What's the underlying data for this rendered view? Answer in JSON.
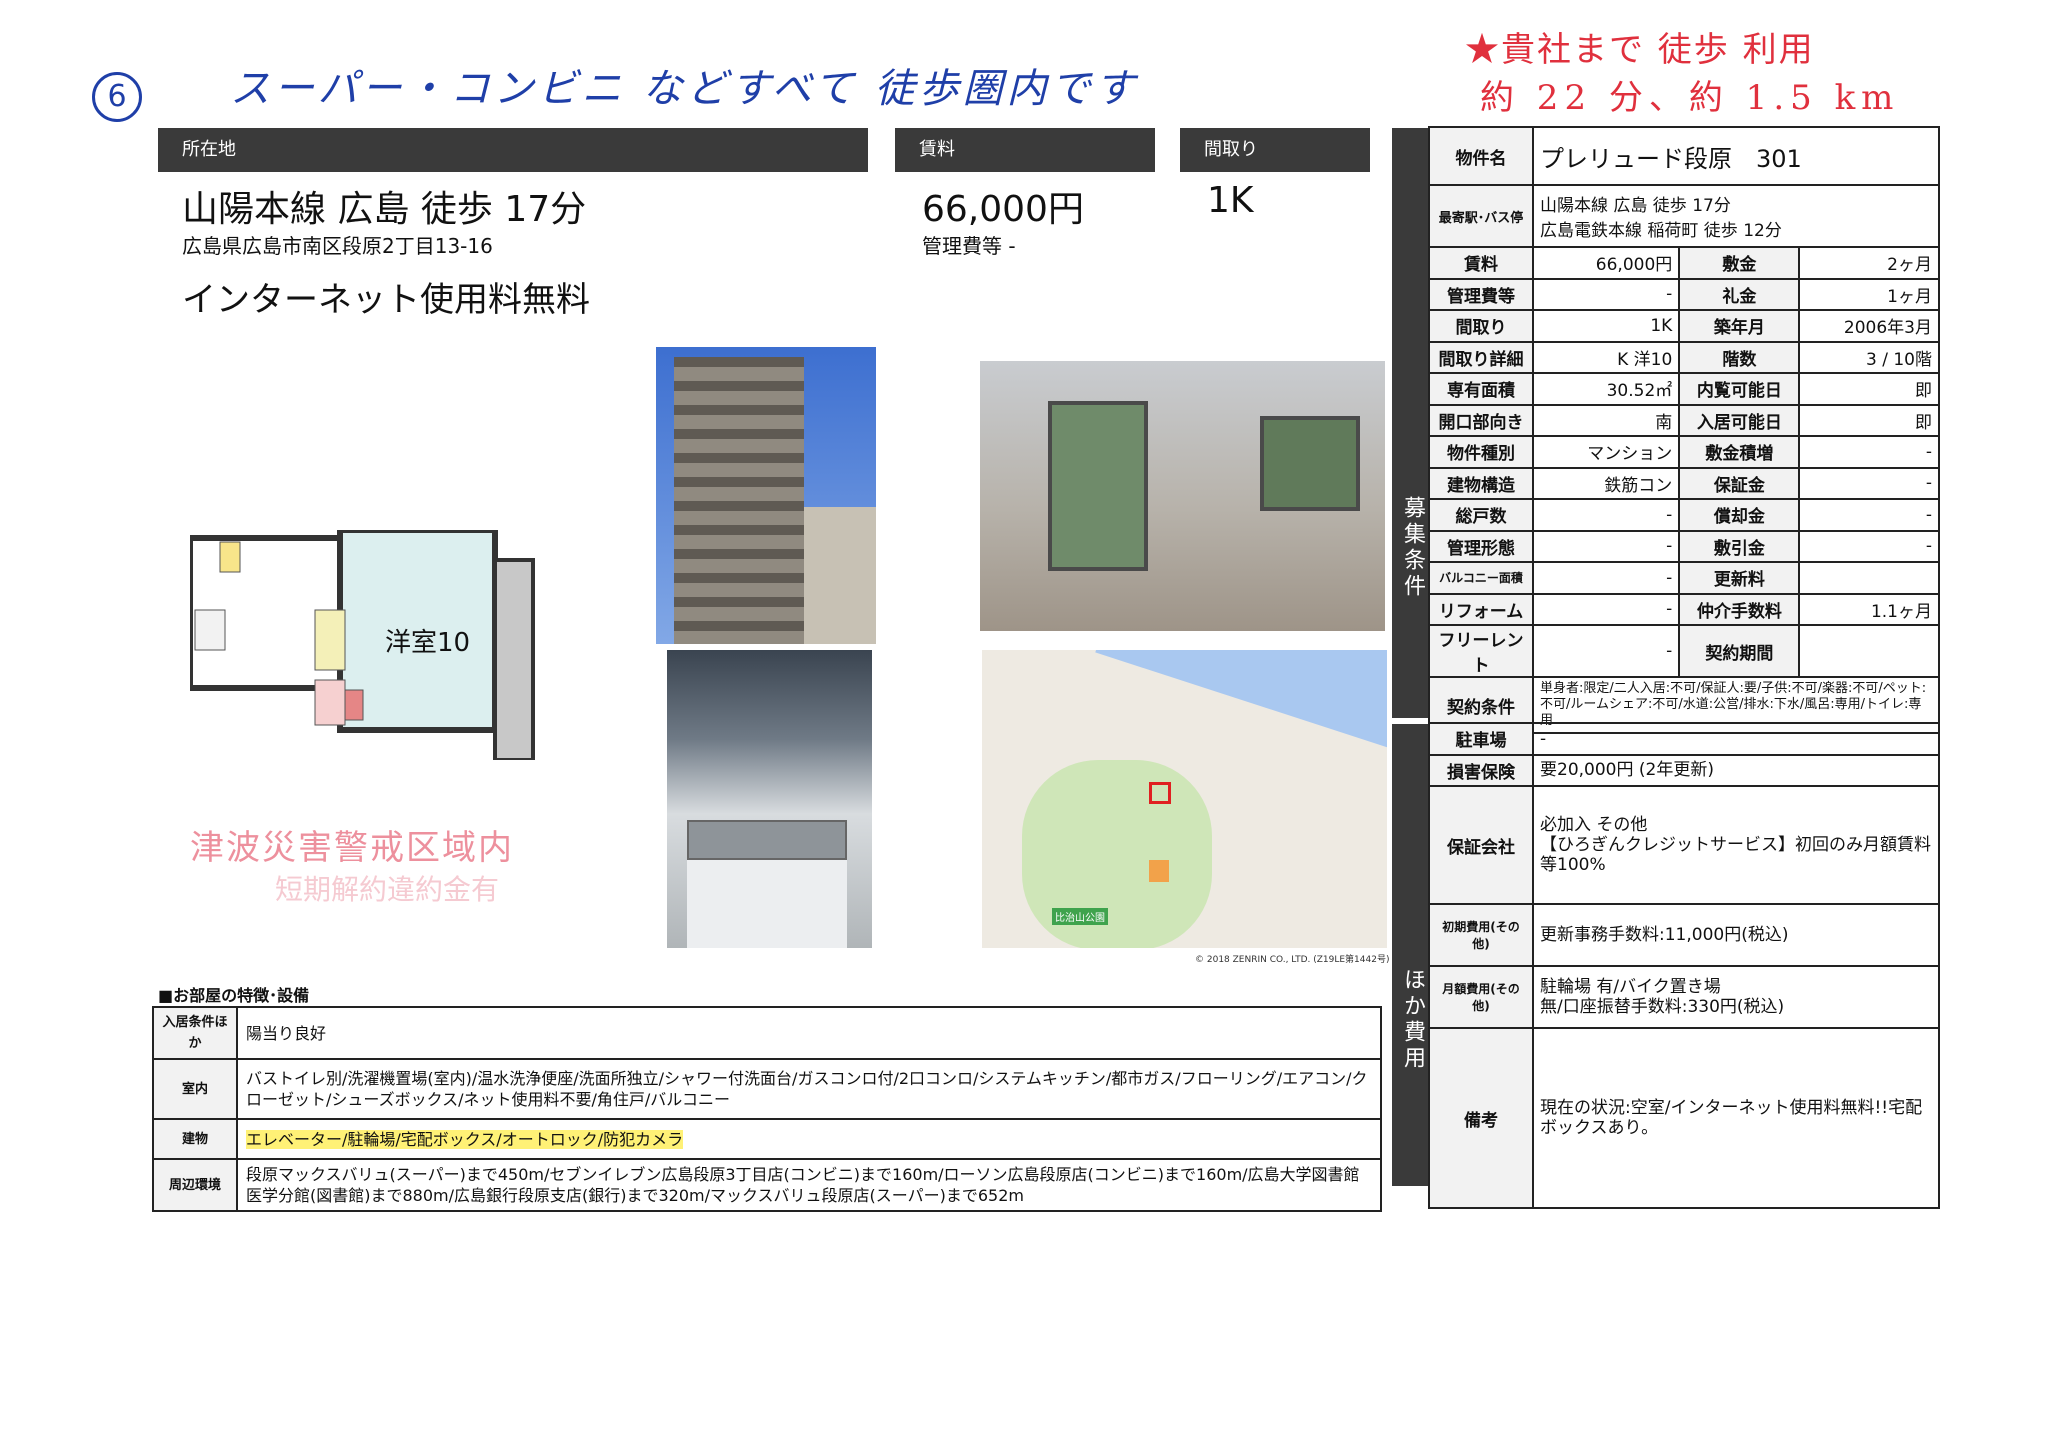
{
  "handwritten": {
    "number": "6",
    "note": "スーパー・コンビニ などすべて 徒歩圏内です",
    "top_right_line1": "★貴社まで 徒歩 利用",
    "top_right_line2": "約 22 分、約 1.5 km"
  },
  "headers": {
    "location": "所在地",
    "rent": "賃料",
    "layout": "間取り"
  },
  "summary": {
    "station": "山陽本線 広島 徒歩 17分",
    "address": "広島県広島市南区段原2丁目13-16",
    "rent": "66,000円",
    "mgmt_fee": "管理費等 -",
    "layout": "1K",
    "catch": "インターネット使用料無料"
  },
  "floorplan": {
    "room_label": "洋室10",
    "stamp_line1": "津波災害警戒区域内",
    "stamp_line2": "短期解約違約金有"
  },
  "map": {
    "copyright": "© 2018 ZENRIN CO., LTD. (Z19LE第1442号)",
    "park_label": "比治山公園"
  },
  "spec": {
    "property_name_label": "物件名",
    "property_name": "プレリュード段原　301",
    "station_label": "最寄駅･バス停",
    "station_line1": "山陽本線 広島 徒歩 17分",
    "station_line2": "広島電鉄本線 稲荷町 徒歩 12分",
    "section_label": "募集条件",
    "rows": [
      {
        "l1": "賃料",
        "v1": "66,000円",
        "l2": "敷金",
        "v2": "2ヶ月"
      },
      {
        "l1": "管理費等",
        "v1": "-",
        "l2": "礼金",
        "v2": "1ヶ月"
      },
      {
        "l1": "間取り",
        "v1": "1K",
        "l2": "築年月",
        "v2": "2006年3月"
      },
      {
        "l1": "間取り詳細",
        "v1": "K 洋10",
        "l2": "階数",
        "v2": "3 / 10階"
      },
      {
        "l1": "専有面積",
        "v1": "30.52㎡",
        "l2": "内覧可能日",
        "v2": "即"
      },
      {
        "l1": "開口部向き",
        "v1": "南",
        "l2": "入居可能日",
        "v2": "即"
      },
      {
        "l1": "物件種別",
        "v1": "マンション",
        "l2": "敷金積増",
        "v2": "-"
      },
      {
        "l1": "建物構造",
        "v1": "鉄筋コン",
        "l2": "保証金",
        "v2": "-"
      },
      {
        "l1": "総戸数",
        "v1": "-",
        "l2": "償却金",
        "v2": "-"
      },
      {
        "l1": "管理形態",
        "v1": "-",
        "l2": "敷引金",
        "v2": "-"
      },
      {
        "l1": "バルコニー面積",
        "v1": "-",
        "l2": "更新料",
        "v2": ""
      },
      {
        "l1": "リフォーム",
        "v1": "-",
        "l2": "仲介手数料",
        "v2": "1.1ヶ月"
      },
      {
        "l1": "フリーレント",
        "v1": "-",
        "l2": "契約期間",
        "v2": ""
      }
    ],
    "contract_label": "契約条件",
    "contract_text": "単身者:限定/二人入居:不可/保証人:要/子供:不可/楽器:不可/ペット:不可/ルームシェア:不可/水道:公営/排水:下水/風呂:専用/トイレ:専用"
  },
  "costs": {
    "section_label": "ほか費用",
    "rows": [
      {
        "label": "駐車場",
        "value": "-"
      },
      {
        "label": "損害保険",
        "value": "要20,000円 (2年更新)"
      },
      {
        "label": "保証会社",
        "value": "必加入 その他\n【ひろぎんクレジットサービス】初回のみ月額賃料等100%"
      },
      {
        "label": "初期費用(その他)",
        "value": "更新事務手数料:11,000円(税込)"
      },
      {
        "label": "月額費用(その他)",
        "value": "駐輪場 有/バイク置き場\n無/口座振替手数料:330円(税込)"
      },
      {
        "label": "備考",
        "value": "現在の状況:空室/インターネット使用料無料!!宅配ボックスあり。"
      }
    ]
  },
  "features": {
    "title": "■お部屋の特徴･設備",
    "rows": [
      {
        "label": "入居条件ほか",
        "value": "陽当り良好"
      },
      {
        "label": "室内",
        "value": "バストイレ別/洗濯機置場(室内)/温水洗浄便座/洗面所独立/シャワー付洗面台/ガスコンロ付/2口コンロ/システムキッチン/都市ガス/フローリング/エアコン/クローゼット/シューズボックス/ネット使用料不要/角住戸/バルコニー"
      },
      {
        "label": "建物",
        "value": "エレベーター/駐輪場/宅配ボックス/オートロック/防犯カメラ"
      },
      {
        "label": "周辺環境",
        "value": "段原マックスバリュ(スーパー)まで450m/セブンイレブン広島段原3丁目店(コンビニ)まで160m/ローソン広島段原店(コンビニ)まで160m/広島大学図書館医学分館(図書館)まで880m/広島銀行段原支店(銀行)まで320m/マックスバリュ段原店(スーパー)まで652m"
      }
    ]
  }
}
